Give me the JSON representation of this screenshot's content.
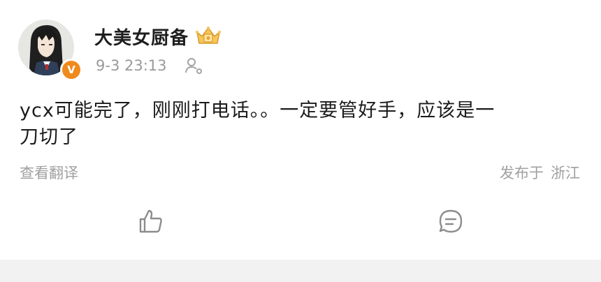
{
  "post": {
    "username": "大美女厨备",
    "time": "9-3 23:13",
    "verified_badge": "V",
    "content_lines": [
      "ycx可能完了，刚刚打电话。。一定要管好手，应该是一",
      "刀切了"
    ],
    "translate_label": "查看翻译",
    "location_prefix": "发布于",
    "location": "浙江"
  },
  "icons": {
    "vip": "vip-crown-icon",
    "follow": "person-follow-icon",
    "like": "thumbs-up-icon",
    "comment": "comment-bubble-icon"
  },
  "colors": {
    "badge": "#f08a1c",
    "meta_text": "#9a9a9a",
    "separator_bar": "#f2f2f2"
  }
}
